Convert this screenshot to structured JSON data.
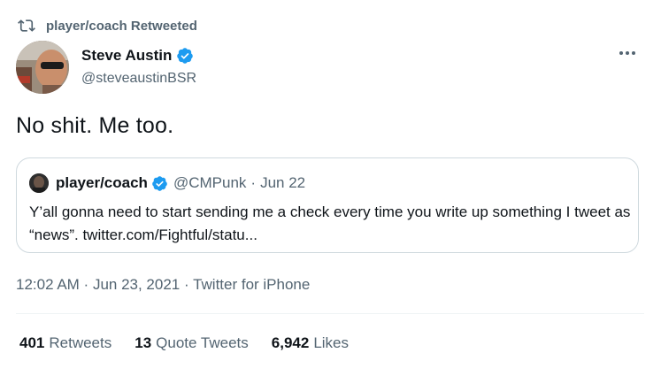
{
  "retweet": {
    "label": "player/coach Retweeted"
  },
  "author": {
    "name": "Steve Austin",
    "handle": "@steveaustinBSR"
  },
  "tweet": {
    "text": "No shit. Me too."
  },
  "quote": {
    "name": "player/coach",
    "handle": "@CMPunk",
    "separator": "·",
    "date": "Jun 22",
    "text": "Y’all gonna need to start sending me a check every time you write up something I tweet as “news”. twitter.com/Fightful/statu..."
  },
  "meta": {
    "time": "12:02 AM",
    "sep1": " · ",
    "date": "Jun 23, 2021",
    "sep2": " · ",
    "source": "Twitter for iPhone"
  },
  "stats": {
    "retweets": {
      "count": "401",
      "label": "Retweets"
    },
    "quotes": {
      "count": "13",
      "label": "Quote Tweets"
    },
    "likes": {
      "count": "6,942",
      "label": "Likes"
    }
  },
  "colors": {
    "verified": "#1d9bf0",
    "secondary_text": "#536471",
    "primary_text": "#0f1419"
  }
}
